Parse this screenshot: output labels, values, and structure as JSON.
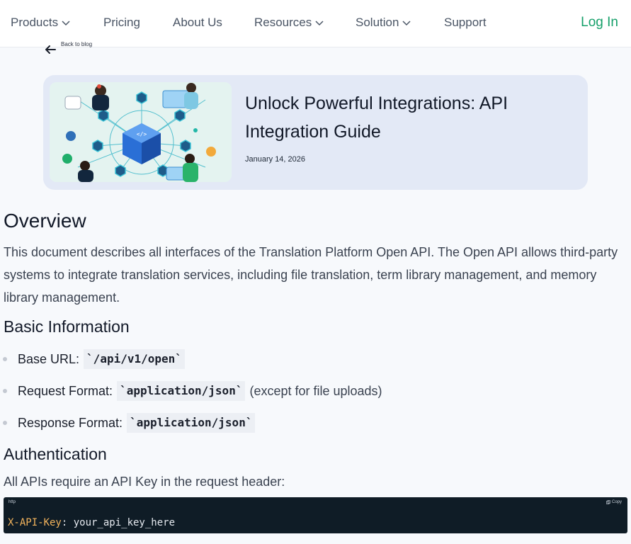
{
  "nav": {
    "items": [
      {
        "label": "Products",
        "has_dropdown": true
      },
      {
        "label": "Pricing",
        "has_dropdown": false
      },
      {
        "label": "About Us",
        "has_dropdown": false
      },
      {
        "label": "Resources",
        "has_dropdown": true
      },
      {
        "label": "Solution",
        "has_dropdown": true
      },
      {
        "label": "Support",
        "has_dropdown": false
      }
    ],
    "login_label": "Log In",
    "accent_color": "#16a06a"
  },
  "back": {
    "label": "Back to blog",
    "icon": "arrow-left-icon"
  },
  "hero": {
    "title": "Unlock Powerful Integrations: API Integration Guide",
    "date": "January 14, 2026",
    "image_icon": "api-integration-illustration"
  },
  "article": {
    "overview_heading": "Overview",
    "overview_text": "This document describes all interfaces of the Translation Platform Open API. The Open API allows third-party systems to integrate translation services, including file translation, term library management, and memory library management.",
    "basic_heading": "Basic Information",
    "basic_items": [
      {
        "label": "Base URL:",
        "code": "`/api/v1/open`",
        "after": ""
      },
      {
        "label": "Request Format:",
        "code": "`application/json`",
        "after": "(except for file uploads)"
      },
      {
        "label": "Response Format:",
        "code": "`application/json`",
        "after": ""
      }
    ],
    "auth_heading": "Authentication",
    "auth_text": "All APIs require an API Key in the request header:",
    "code_block": {
      "language": "http",
      "copy_label": "Copy",
      "key": "X-API-Key",
      "value": ": your_api_key_here"
    }
  }
}
